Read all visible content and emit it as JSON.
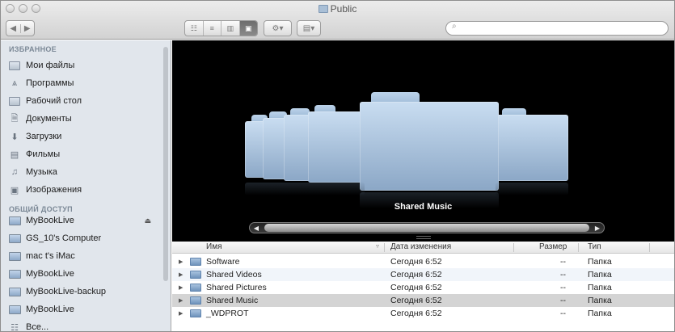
{
  "window": {
    "title": "Public"
  },
  "toolbar": {
    "back": "◀",
    "forward": "▶",
    "view_buttons": [
      "☷",
      "≡",
      "▥",
      "▣"
    ],
    "action_label": "⚙▾",
    "arrange_label": "▤▾",
    "search": {
      "value": "",
      "placeholder": ""
    }
  },
  "sidebar": {
    "favorites_header": "ИЗБРАННОЕ",
    "favorites": [
      {
        "label": "Мои файлы",
        "icon": "all-files-icon"
      },
      {
        "label": "Программы",
        "icon": "applications-icon"
      },
      {
        "label": "Рабочий стол",
        "icon": "desktop-icon"
      },
      {
        "label": "Документы",
        "icon": "documents-icon"
      },
      {
        "label": "Загрузки",
        "icon": "downloads-icon"
      },
      {
        "label": "Фильмы",
        "icon": "movies-icon"
      },
      {
        "label": "Музыка",
        "icon": "music-icon"
      },
      {
        "label": "Изображения",
        "icon": "pictures-icon"
      }
    ],
    "shared_header": "ОБЩИЙ ДОСТУП",
    "shared": [
      {
        "label": "MyBookLive",
        "eject": true
      },
      {
        "label": "GS_10's Computer"
      },
      {
        "label": "mac t's iMac"
      },
      {
        "label": "MyBookLive"
      },
      {
        "label": "MyBookLive-backup"
      },
      {
        "label": "MyBookLive"
      },
      {
        "label": "Все..."
      }
    ]
  },
  "coverflow": {
    "selected_caption": "Shared Music"
  },
  "list": {
    "columns": {
      "name": "Имя",
      "date": "Дата изменения",
      "size": "Размер",
      "kind": "Тип"
    },
    "rows": [
      {
        "name": "Software",
        "date": "Сегодня 6:52",
        "size": "--",
        "kind": "Папка"
      },
      {
        "name": "Shared Videos",
        "date": "Сегодня 6:52",
        "size": "--",
        "kind": "Папка"
      },
      {
        "name": "Shared Pictures",
        "date": "Сегодня 6:52",
        "size": "--",
        "kind": "Папка"
      },
      {
        "name": "Shared Music",
        "date": "Сегодня 6:52",
        "size": "--",
        "kind": "Папка",
        "selected": true
      },
      {
        "name": "_WDPROT",
        "date": "Сегодня 6:52",
        "size": "--",
        "kind": "Папка"
      }
    ]
  },
  "colors": {
    "sidebar_bg": "#e1e6ec",
    "coverflow_bg": "#000000",
    "selection": "#d4d4d4",
    "folder_blue": "#9fbbd8"
  }
}
